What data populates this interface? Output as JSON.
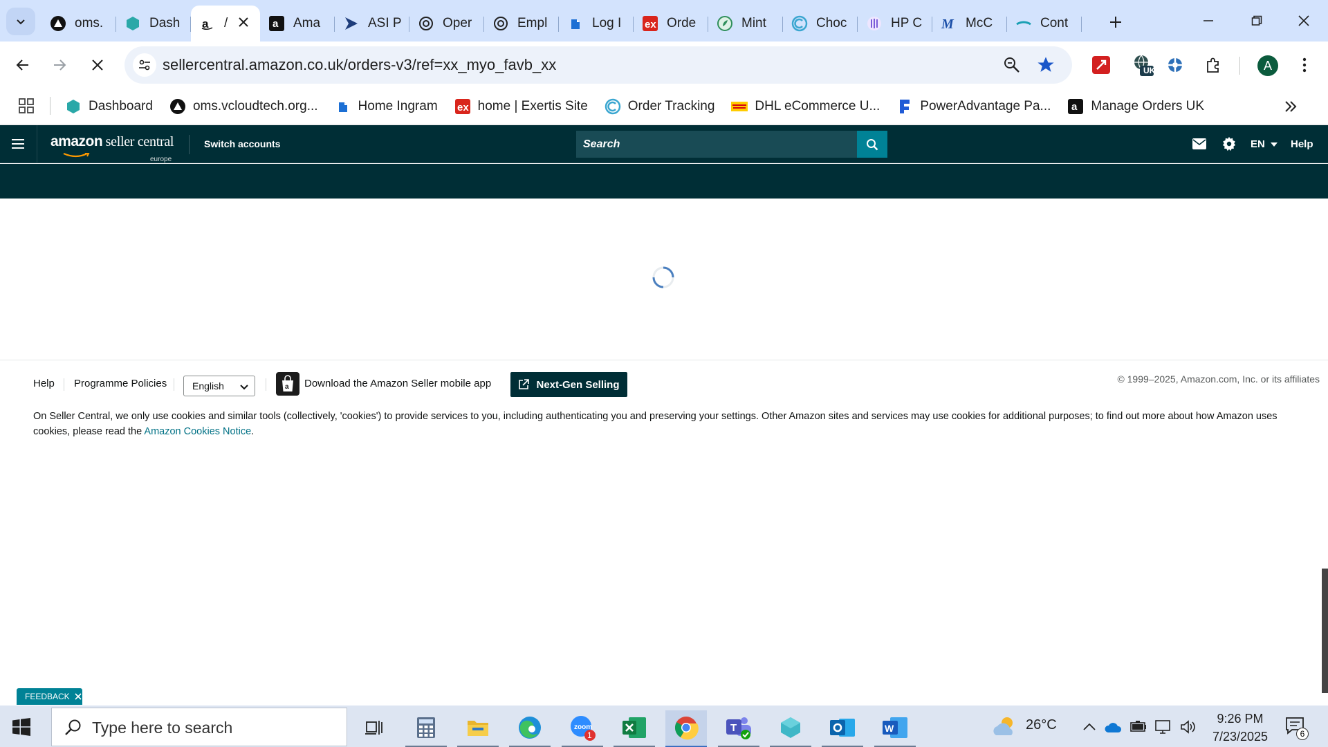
{
  "browser": {
    "tabs": [
      {
        "title": "oms.",
        "icon": "vcloud-icon"
      },
      {
        "title": "Dash",
        "icon": "dashboard-icon"
      },
      {
        "title": "/",
        "icon": "amazon-icon",
        "active": true
      },
      {
        "title": "Ama",
        "icon": "amazon-icon"
      },
      {
        "title": "ASI P",
        "icon": "asi-icon"
      },
      {
        "title": "Oper",
        "icon": "openai-icon"
      },
      {
        "title": "Empl",
        "icon": "openai-icon"
      },
      {
        "title": "Log I",
        "icon": "ingram-icon"
      },
      {
        "title": "Orde",
        "icon": "exertis-icon"
      },
      {
        "title": "Mint",
        "icon": "mint-icon"
      },
      {
        "title": "Choc",
        "icon": "chocolatey-icon"
      },
      {
        "title": "HP C",
        "icon": "hp-icon"
      },
      {
        "title": "McC",
        "icon": "mcc-icon"
      },
      {
        "title": "Cont",
        "icon": "cont-icon"
      }
    ],
    "url": "sellercentral.amazon.co.uk/orders-v3/ref=xx_myo_favb_xx",
    "profile_initial": "A",
    "extension_badge": "UK",
    "bookmarks": [
      {
        "label": "Dashboard",
        "icon": "dashboard-icon"
      },
      {
        "label": "oms.vcloudtech.org...",
        "icon": "vcloud-icon"
      },
      {
        "label": "Home Ingram",
        "icon": "ingram-icon"
      },
      {
        "label": "home | Exertis Site",
        "icon": "exertis-icon"
      },
      {
        "label": "Order Tracking",
        "icon": "chocolatey-icon"
      },
      {
        "label": "DHL eCommerce U...",
        "icon": "dhl-icon"
      },
      {
        "label": "PowerAdvantage Pa...",
        "icon": "poweradvantage-icon"
      },
      {
        "label": "Manage Orders UK",
        "icon": "amazon-icon"
      }
    ]
  },
  "seller_central": {
    "logo_word": "amazon",
    "logo_word2": "seller central",
    "logo_region": "europe",
    "switch_accounts": "Switch accounts",
    "search_placeholder": "Search",
    "lang": "EN",
    "help": "Help"
  },
  "footer": {
    "help": "Help",
    "policies": "Programme Policies",
    "language": "English",
    "app_download": "Download the Amazon Seller mobile app",
    "next_gen": "Next-Gen Selling",
    "copyright": "© 1999–2025, Amazon.com, Inc. or its affiliates",
    "cookie_text": "On Seller Central, we only use cookies and similar tools (collectively, 'cookies') to provide services to you, including authenticating you and preserving your settings. Other Amazon sites and services may use cookies for additional purposes; to find out more about how Amazon uses cookies, please read the",
    "cookie_link": "Amazon Cookies Notice",
    "cookie_end": "."
  },
  "feedback": "FEEDBACK",
  "taskbar": {
    "search_placeholder": "Type here to search",
    "zoom_badge": "1",
    "weather": "26°C",
    "time": "9:26 PM",
    "date": "7/23/2025",
    "notifications": "6"
  },
  "colors": {
    "header": "#002e36",
    "accent": "#008296",
    "tabstrip": "#d3e3fd"
  }
}
